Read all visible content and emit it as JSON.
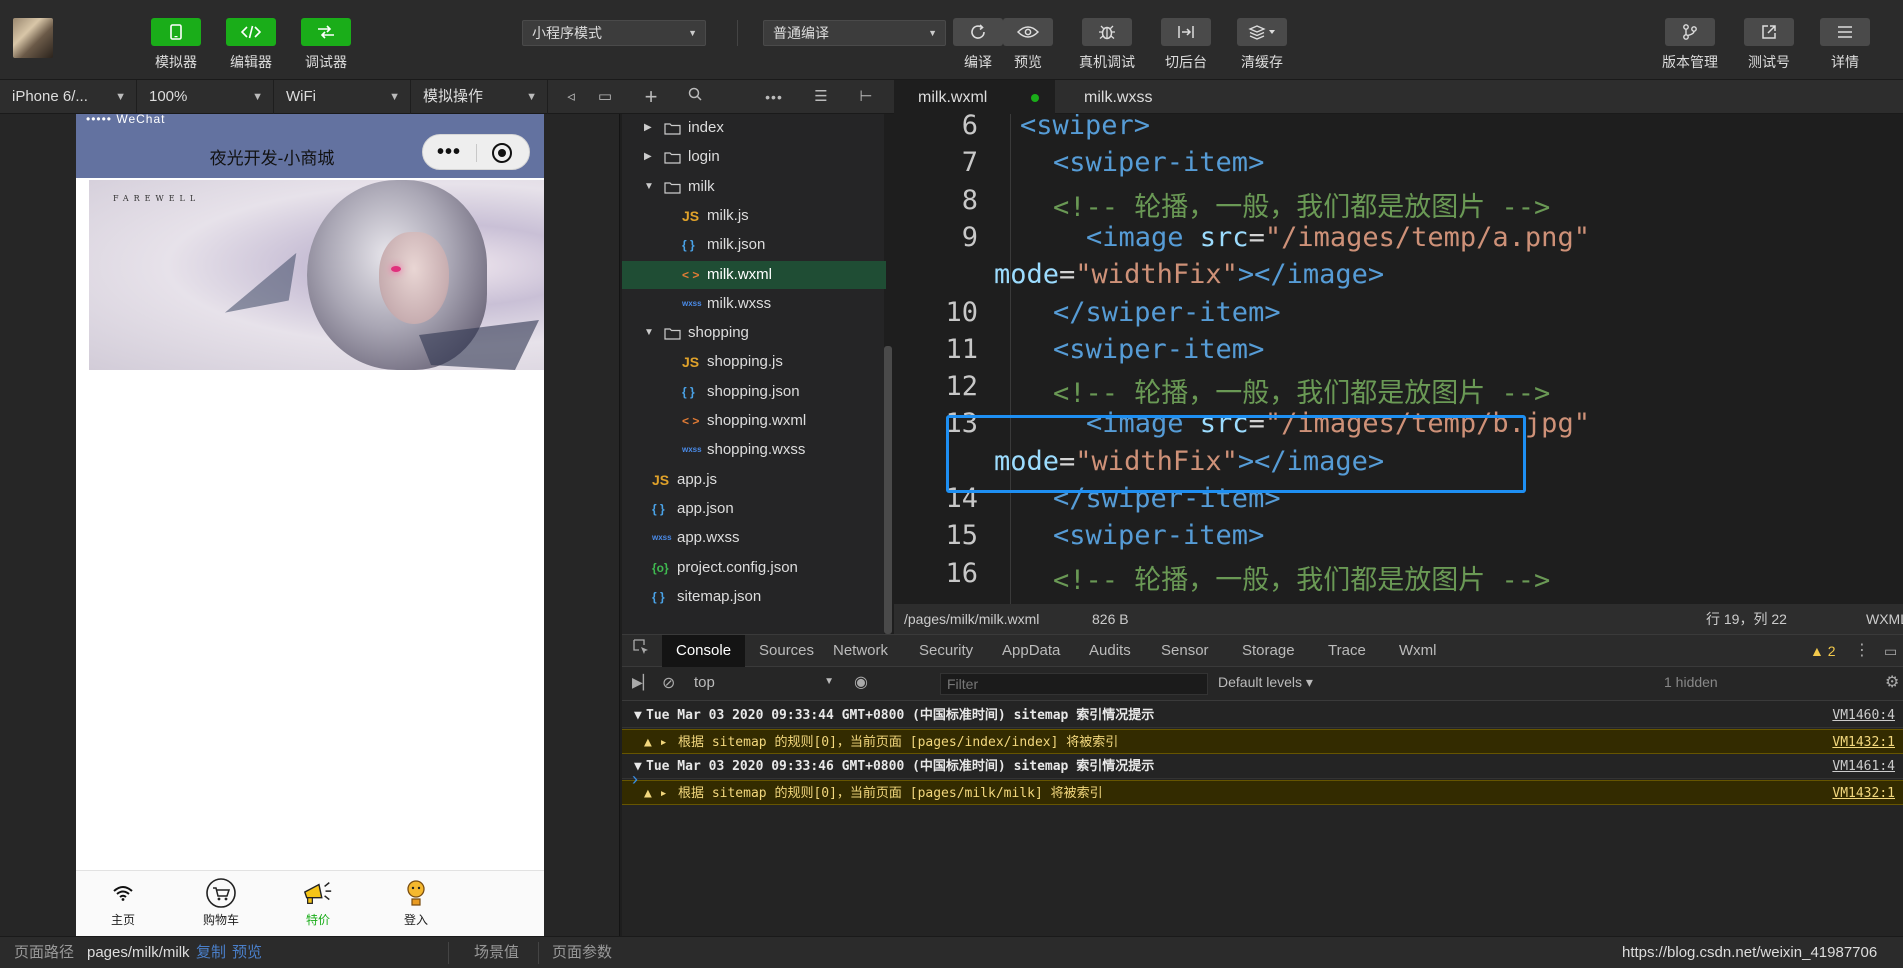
{
  "toolbar": {
    "buttons_left": [
      {
        "label": "模拟器",
        "icon": "phone-icon"
      },
      {
        "label": "编辑器",
        "icon": "code-icon"
      },
      {
        "label": "调试器",
        "icon": "debug-icon"
      }
    ],
    "mode_select": "小程序模式",
    "compile_select": "普通编译",
    "actions": [
      {
        "label": "编译",
        "icon": "refresh-icon"
      },
      {
        "label": "预览",
        "icon": "eye-icon"
      },
      {
        "label": "真机调试",
        "icon": "bug-icon"
      },
      {
        "label": "切后台",
        "icon": "switch-icon"
      },
      {
        "label": "清缓存",
        "icon": "layers-icon"
      }
    ],
    "right_actions": [
      {
        "label": "版本管理",
        "icon": "branch-icon"
      },
      {
        "label": "测试号",
        "icon": "external-icon"
      },
      {
        "label": "详情",
        "icon": "menu-icon"
      }
    ]
  },
  "subbar": {
    "device": "iPhone 6/...",
    "zoom": "100%",
    "network": "WiFi",
    "operation": "模拟操作"
  },
  "editor_tabs": [
    {
      "label": "milk.wxml",
      "active": true,
      "modified": true
    },
    {
      "label": "milk.wxss",
      "active": false
    }
  ],
  "simulator": {
    "status_text": "••••• WeChat",
    "nav_title": "夜光开发-小商城",
    "banner_brand": "FAREWELL",
    "tabs": [
      {
        "label": "主页",
        "icon": "wifi-icon",
        "selected": false
      },
      {
        "label": "购物车",
        "icon": "cart-icon",
        "selected": false
      },
      {
        "label": "特价",
        "icon": "megaphone-icon",
        "selected": true
      },
      {
        "label": "登入",
        "icon": "login-icon",
        "selected": false
      }
    ]
  },
  "file_tree": [
    {
      "name": "index",
      "type": "folder",
      "depth": 1,
      "expanded": false
    },
    {
      "name": "login",
      "type": "folder",
      "depth": 1,
      "expanded": false
    },
    {
      "name": "milk",
      "type": "folder",
      "depth": 1,
      "expanded": true
    },
    {
      "name": "milk.js",
      "type": "js",
      "depth": 2
    },
    {
      "name": "milk.json",
      "type": "json",
      "depth": 2
    },
    {
      "name": "milk.wxml",
      "type": "wxml",
      "depth": 2,
      "selected": true
    },
    {
      "name": "milk.wxss",
      "type": "wxss",
      "depth": 2
    },
    {
      "name": "shopping",
      "type": "folder",
      "depth": 1,
      "expanded": true
    },
    {
      "name": "shopping.js",
      "type": "js",
      "depth": 2
    },
    {
      "name": "shopping.json",
      "type": "json",
      "depth": 2
    },
    {
      "name": "shopping.wxml",
      "type": "wxml",
      "depth": 2
    },
    {
      "name": "shopping.wxss",
      "type": "wxss",
      "depth": 2
    },
    {
      "name": "app.js",
      "type": "js",
      "depth": 1
    },
    {
      "name": "app.json",
      "type": "json",
      "depth": 1
    },
    {
      "name": "app.wxss",
      "type": "wxss",
      "depth": 1
    },
    {
      "name": "project.config.json",
      "type": "cfg",
      "depth": 1
    },
    {
      "name": "sitemap.json",
      "type": "json",
      "depth": 1
    }
  ],
  "code_lines": [
    {
      "n": "6",
      "indent": 1,
      "tokens": [
        [
          "tag",
          "<swiper>"
        ]
      ]
    },
    {
      "n": "7",
      "indent": 2,
      "tokens": [
        [
          "tag",
          "<swiper-item>"
        ]
      ]
    },
    {
      "n": "8",
      "indent": 2,
      "tokens": [
        [
          "com",
          "<!-- 轮播，一般，我们都是放图片 -->"
        ]
      ]
    },
    {
      "n": "9",
      "indent": 3,
      "tokens": [
        [
          "tag",
          "<image "
        ],
        [
          "attr",
          "src"
        ],
        [
          "txt",
          "="
        ],
        [
          "str",
          "\"/images/temp/a.png\""
        ]
      ]
    },
    {
      "n": "",
      "indent": 0,
      "tokens": [
        [
          "attr",
          "mode"
        ],
        [
          "txt",
          "="
        ],
        [
          "str",
          "\"widthFix\""
        ],
        [
          "tag",
          "></image>"
        ]
      ]
    },
    {
      "n": "10",
      "indent": 2,
      "tokens": [
        [
          "tag",
          "</swiper-item>"
        ]
      ]
    },
    {
      "n": "11",
      "indent": 2,
      "tokens": [
        [
          "tag",
          "<swiper-item>"
        ]
      ]
    },
    {
      "n": "12",
      "indent": 2,
      "tokens": [
        [
          "com",
          "<!-- 轮播，一般，我们都是放图片 -->"
        ]
      ]
    },
    {
      "n": "13",
      "indent": 3,
      "tokens": [
        [
          "tag",
          "<image "
        ],
        [
          "attr",
          "src"
        ],
        [
          "txt",
          "="
        ],
        [
          "str",
          "\"/images/temp/b.jpg\""
        ]
      ]
    },
    {
      "n": "",
      "indent": 0,
      "tokens": [
        [
          "attr",
          "mode"
        ],
        [
          "txt",
          "="
        ],
        [
          "str",
          "\"widthFix\""
        ],
        [
          "tag",
          "></image>"
        ]
      ]
    },
    {
      "n": "14",
      "indent": 2,
      "tokens": [
        [
          "tag",
          "</swiper-item>"
        ]
      ]
    },
    {
      "n": "15",
      "indent": 2,
      "tokens": [
        [
          "tag",
          "<swiper-item>"
        ]
      ]
    },
    {
      "n": "16",
      "indent": 2,
      "tokens": [
        [
          "com",
          "<!-- 轮播，一般，我们都是放图片 -->"
        ]
      ]
    }
  ],
  "statusline": {
    "path": "/pages/milk/milk.wxml",
    "size": "826 B",
    "position": "行 19，列 22",
    "lang": "WXML"
  },
  "devtools": {
    "tabs": [
      "Console",
      "Sources",
      "Network",
      "Security",
      "AppData",
      "Audits",
      "Sensor",
      "Storage",
      "Trace",
      "Wxml"
    ],
    "warning_count": "2",
    "context": "top",
    "filter_placeholder": "Filter",
    "levels": "Default levels",
    "hidden": "1 hidden",
    "logs": [
      {
        "kind": "group",
        "text": "Tue Mar 03 2020 09:33:44 GMT+0800 (中国标准时间) sitemap 索引情况提示",
        "src": "VM1460:4"
      },
      {
        "kind": "warn",
        "text": "根据 sitemap 的规则[0]，当前页面 [pages/index/index] 将被索引",
        "src": "VM1432:1"
      },
      {
        "kind": "group",
        "text": "Tue Mar 03 2020 09:33:46 GMT+0800 (中国标准时间) sitemap 索引情况提示",
        "src": "VM1461:4"
      },
      {
        "kind": "warn",
        "text": "根据 sitemap 的规则[0]，当前页面 [pages/milk/milk] 将被索引",
        "src": "VM1432:1"
      }
    ],
    "prompt": "›"
  },
  "bottombar": {
    "path_label": "页面路径",
    "path": "pages/milk/milk",
    "copy": "复制",
    "preview": "预览",
    "scene": "场景值",
    "params": "页面参数",
    "watermark": "https://blog.csdn.net/weixin_41987706"
  },
  "colors": {
    "accent": "#1aad19",
    "highlight_box": "#1e8ff2",
    "nav_bar": "#6372a0"
  }
}
